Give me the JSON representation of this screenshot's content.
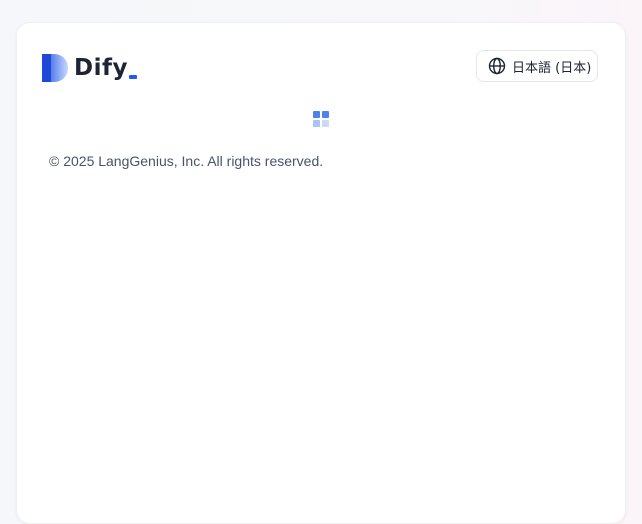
{
  "brand": {
    "name": "Dify",
    "accent": "#1e5af5"
  },
  "language_switcher": {
    "icon": "globe-icon",
    "label": "日本語 (日本)"
  },
  "loading": {
    "icon": "loading-grid-icon"
  },
  "footer": {
    "copyright": "© 2025 LangGenius, Inc. All rights reserved."
  }
}
